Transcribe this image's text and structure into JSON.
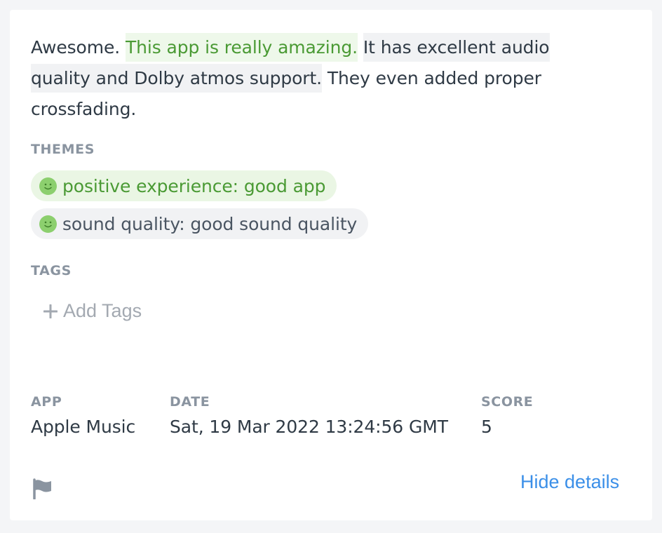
{
  "review": {
    "part1": "Awesome. ",
    "part2": "This app is really amazing.",
    "part3": " ",
    "part4": "It has excellent audio quality and Dolby atmos support.",
    "part5": " They even added proper crossfading."
  },
  "themes": {
    "label": "THEMES",
    "items": [
      {
        "text": "positive experience: good app",
        "sentiment": "positive",
        "color": "#4a9a34"
      },
      {
        "text": "sound quality: good sound quality",
        "sentiment": "positive",
        "color": "#4a5562"
      }
    ],
    "icon": "smiley-face-icon"
  },
  "tags": {
    "label": "TAGS",
    "add_label": "Add Tags"
  },
  "meta": {
    "app_label": "APP",
    "app_value": "Apple Music",
    "date_label": "DATE",
    "date_value": "Sat, 19 Mar 2022 13:24:56 GMT",
    "score_label": "SCORE",
    "score_value": "5"
  },
  "footer": {
    "flag_icon": "flag-icon",
    "hide_details_label": "Hide details"
  },
  "colors": {
    "positive_text": "#4a9a34",
    "positive_bg": "#eaf6e4",
    "link": "#3b8fe8",
    "muted_label": "#8a94a0"
  }
}
